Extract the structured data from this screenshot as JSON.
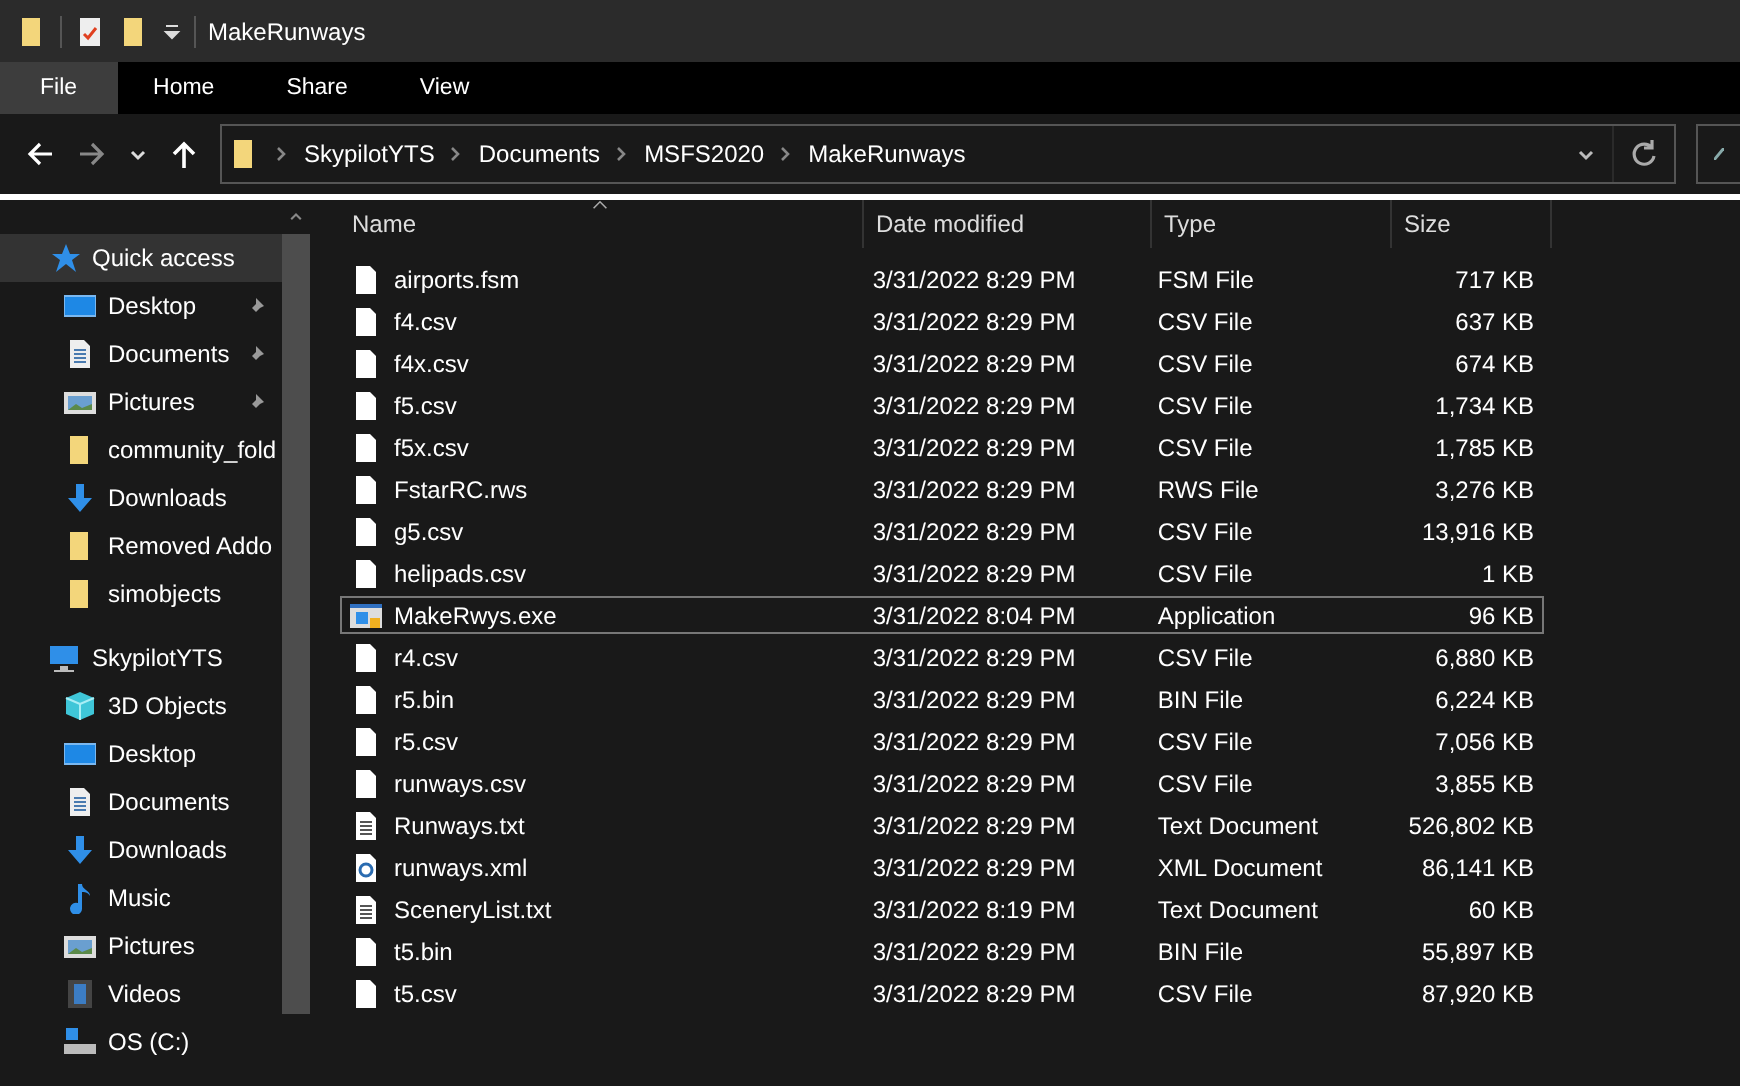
{
  "window": {
    "title": "MakeRunways"
  },
  "ribbon_tabs": [
    {
      "label": "File",
      "selected": true
    },
    {
      "label": "Home",
      "selected": false
    },
    {
      "label": "Share",
      "selected": false
    },
    {
      "label": "View",
      "selected": false
    }
  ],
  "address_bar": {
    "path": [
      "SkypilotYTS",
      "Documents",
      "MSFS2020",
      "MakeRunways"
    ]
  },
  "sidebar": {
    "items": [
      {
        "label": "Quick access",
        "kind": "star",
        "selected": true,
        "children": [
          {
            "label": "Desktop",
            "kind": "desktop",
            "selected": false,
            "pinned": true
          },
          {
            "label": "Documents",
            "kind": "documents",
            "selected": false,
            "pinned": true
          },
          {
            "label": "Pictures",
            "kind": "pictures",
            "selected": false,
            "pinned": true
          },
          {
            "label": "community_fold",
            "kind": "folder",
            "selected": false,
            "pinned": false
          },
          {
            "label": "Downloads",
            "kind": "downloads",
            "selected": false,
            "pinned": false
          },
          {
            "label": "Removed Addo",
            "kind": "folder",
            "selected": false,
            "pinned": false
          },
          {
            "label": "simobjects",
            "kind": "folder",
            "selected": false,
            "pinned": false
          }
        ]
      },
      {
        "label": "SkypilotYTS",
        "kind": "pc",
        "selected": false,
        "children": [
          {
            "label": "3D Objects",
            "kind": "cube",
            "selected": false,
            "pinned": false
          },
          {
            "label": "Desktop",
            "kind": "desktop",
            "selected": false,
            "pinned": false
          },
          {
            "label": "Documents",
            "kind": "documents",
            "selected": false,
            "pinned": false
          },
          {
            "label": "Downloads",
            "kind": "downloads",
            "selected": false,
            "pinned": false
          },
          {
            "label": "Music",
            "kind": "music",
            "selected": false,
            "pinned": false
          },
          {
            "label": "Pictures",
            "kind": "pictures",
            "selected": false,
            "pinned": false
          },
          {
            "label": "Videos",
            "kind": "videos",
            "selected": false,
            "pinned": false
          },
          {
            "label": "OS (C:)",
            "kind": "drive",
            "selected": false,
            "pinned": false
          }
        ]
      }
    ]
  },
  "table": {
    "columns": [
      "Name",
      "Date modified",
      "Type",
      "Size"
    ],
    "rows": [
      {
        "name": "airports.fsm",
        "date": "3/31/2022 8:29 PM",
        "type": "FSM File",
        "size": "717 KB",
        "kind": "blank",
        "selected": false
      },
      {
        "name": "f4.csv",
        "date": "3/31/2022 8:29 PM",
        "type": "CSV File",
        "size": "637 KB",
        "kind": "blank",
        "selected": false
      },
      {
        "name": "f4x.csv",
        "date": "3/31/2022 8:29 PM",
        "type": "CSV File",
        "size": "674 KB",
        "kind": "blank",
        "selected": false
      },
      {
        "name": "f5.csv",
        "date": "3/31/2022 8:29 PM",
        "type": "CSV File",
        "size": "1,734 KB",
        "kind": "blank",
        "selected": false
      },
      {
        "name": "f5x.csv",
        "date": "3/31/2022 8:29 PM",
        "type": "CSV File",
        "size": "1,785 KB",
        "kind": "blank",
        "selected": false
      },
      {
        "name": "FstarRC.rws",
        "date": "3/31/2022 8:29 PM",
        "type": "RWS File",
        "size": "3,276 KB",
        "kind": "blank",
        "selected": false
      },
      {
        "name": "g5.csv",
        "date": "3/31/2022 8:29 PM",
        "type": "CSV File",
        "size": "13,916 KB",
        "kind": "blank",
        "selected": false
      },
      {
        "name": "helipads.csv",
        "date": "3/31/2022 8:29 PM",
        "type": "CSV File",
        "size": "1 KB",
        "kind": "blank",
        "selected": false
      },
      {
        "name": "MakeRwys.exe",
        "date": "3/31/2022 8:04 PM",
        "type": "Application",
        "size": "96 KB",
        "kind": "exe",
        "selected": true
      },
      {
        "name": "r4.csv",
        "date": "3/31/2022 8:29 PM",
        "type": "CSV File",
        "size": "6,880 KB",
        "kind": "blank",
        "selected": false
      },
      {
        "name": "r5.bin",
        "date": "3/31/2022 8:29 PM",
        "type": "BIN File",
        "size": "6,224 KB",
        "kind": "blank",
        "selected": false
      },
      {
        "name": "r5.csv",
        "date": "3/31/2022 8:29 PM",
        "type": "CSV File",
        "size": "7,056 KB",
        "kind": "blank",
        "selected": false
      },
      {
        "name": "runways.csv",
        "date": "3/31/2022 8:29 PM",
        "type": "CSV File",
        "size": "3,855 KB",
        "kind": "blank",
        "selected": false
      },
      {
        "name": "Runways.txt",
        "date": "3/31/2022 8:29 PM",
        "type": "Text Document",
        "size": "526,802 KB",
        "kind": "text",
        "selected": false
      },
      {
        "name": "runways.xml",
        "date": "3/31/2022 8:29 PM",
        "type": "XML Document",
        "size": "86,141 KB",
        "kind": "xml",
        "selected": false
      },
      {
        "name": "SceneryList.txt",
        "date": "3/31/2022 8:19 PM",
        "type": "Text Document",
        "size": "60 KB",
        "kind": "text",
        "selected": false
      },
      {
        "name": "t5.bin",
        "date": "3/31/2022 8:29 PM",
        "type": "BIN File",
        "size": "55,897 KB",
        "kind": "blank",
        "selected": false
      },
      {
        "name": "t5.csv",
        "date": "3/31/2022 8:29 PM",
        "type": "CSV File",
        "size": "87,920 KB",
        "kind": "blank",
        "selected": false
      }
    ]
  }
}
